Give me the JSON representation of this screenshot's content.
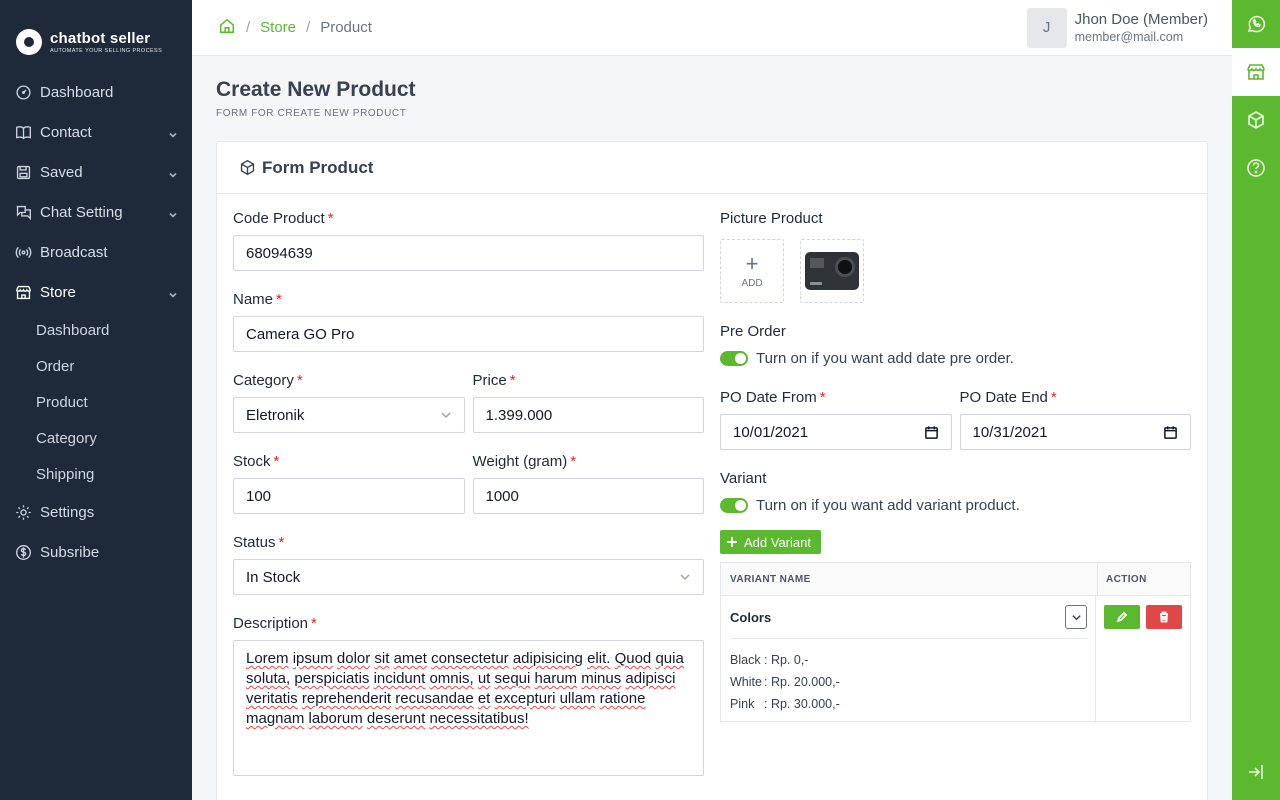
{
  "brand": {
    "name": "chatbot seller",
    "tagline": "AUTOMATE YOUR SELLING PROCESS"
  },
  "sidebar": {
    "items": [
      {
        "label": "Dashboard",
        "icon": "dashboard-icon"
      },
      {
        "label": "Contact",
        "icon": "book-icon"
      },
      {
        "label": "Saved",
        "icon": "save-icon"
      },
      {
        "label": "Chat Setting",
        "icon": "chat-icon"
      },
      {
        "label": "Broadcast",
        "icon": "broadcast-icon"
      },
      {
        "label": "Store",
        "icon": "store-icon"
      },
      {
        "label": "Settings",
        "icon": "gear-icon"
      },
      {
        "label": "Subsribe",
        "icon": "dollar-icon"
      }
    ],
    "store_sub": [
      "Dashboard",
      "Order",
      "Product",
      "Category",
      "Shipping"
    ]
  },
  "breadcrumb": {
    "store": "Store",
    "product": "Product",
    "sep": "/"
  },
  "user": {
    "initial": "J",
    "name": "Jhon Doe (Member)",
    "email": "member@mail.com"
  },
  "page": {
    "title": "Create New Product",
    "subtitle": "FORM FOR CREATE NEW PRODUCT"
  },
  "form": {
    "card_title": "Form Product",
    "code_label": "Code Product",
    "code_value": "68094639",
    "name_label": "Name",
    "name_value": "Camera GO Pro",
    "category_label": "Category",
    "category_value": "Eletronik",
    "price_label": "Price",
    "price_value": "1.399.000",
    "stock_label": "Stock",
    "stock_value": "100",
    "weight_label": "Weight (gram)",
    "weight_value": "1000",
    "status_label": "Status",
    "status_value": "In Stock",
    "desc_label": "Description",
    "desc_value": "Lorem ipsum dolor sit amet consectetur adipisicing elit. Quod quia soluta, perspiciatis incidunt omnis, ut sequi harum minus adipisci veritatis reprehenderit recusandae et excepturi ullam ratione magnam laborum deserunt necessitatibus!",
    "picture_label": "Picture Product",
    "add_label": "ADD",
    "preorder_label": "Pre Order",
    "preorder_hint": "Turn on if you want add date pre order.",
    "po_from_label": "PO Date From",
    "po_from_value": "10/01/2021",
    "po_end_label": "PO Date End",
    "po_end_value": "10/31/2021",
    "variant_label": "Variant",
    "variant_hint": "Turn on if you want add variant product.",
    "add_variant": "Add Variant",
    "required_mark": "*"
  },
  "variant_table": {
    "headers": [
      "VARIANT NAME",
      "ACTION"
    ],
    "rows": [
      {
        "name": "Colors",
        "options": [
          {
            "key": "Black",
            "value": ": Rp. 0,-"
          },
          {
            "key": "White",
            "value": ": Rp. 20.000,-"
          },
          {
            "key": "Pink",
            "value": ": Rp. 30.000,-"
          }
        ]
      }
    ]
  },
  "colors": {
    "accent": "#5cb82f",
    "sidebar": "#1e2a3a",
    "danger": "#e04848"
  }
}
